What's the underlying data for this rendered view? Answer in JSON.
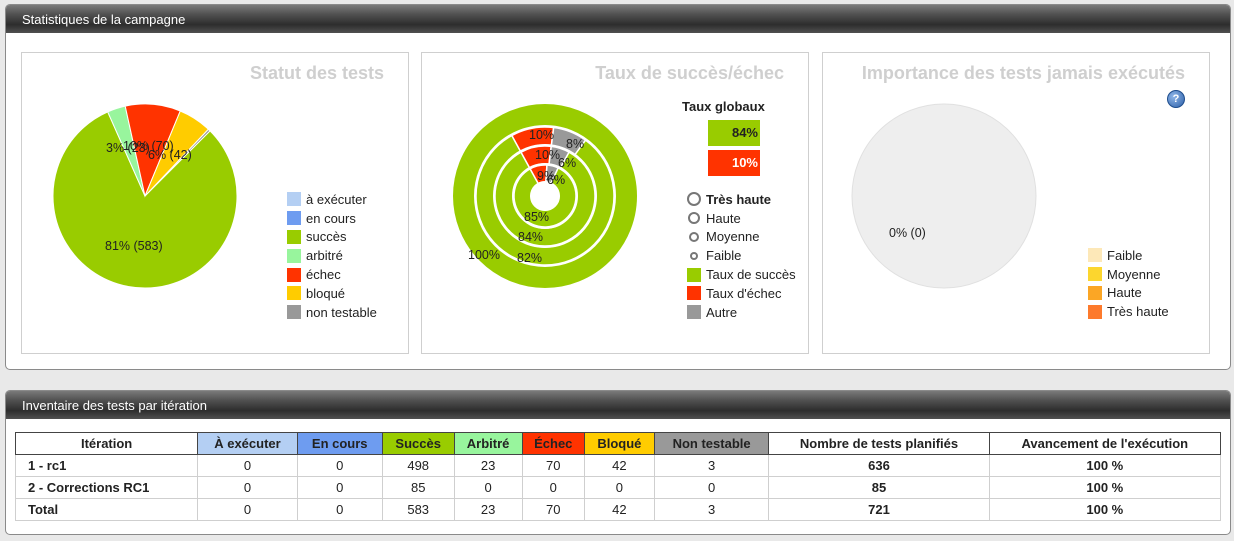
{
  "campaign_panel": {
    "title": "Statistiques de la campagne"
  },
  "status_chart": {
    "title": "Statut des tests",
    "legend": [
      {
        "label": "à exécuter",
        "color": "#b4cff3"
      },
      {
        "label": "en cours",
        "color": "#6e9cf0"
      },
      {
        "label": "succès",
        "color": "#99cc00"
      },
      {
        "label": "arbitré",
        "color": "#98f59d"
      },
      {
        "label": "échec",
        "color": "#ff3300"
      },
      {
        "label": "bloqué",
        "color": "#ffcc00"
      },
      {
        "label": "non testable",
        "color": "#999999"
      }
    ],
    "labels": {
      "success": "81% (583)",
      "arbitrated": "3% (23)",
      "failure": "10% (70)",
      "blocked": "6% (42)"
    }
  },
  "rate_chart": {
    "title": "Taux de succès/échec",
    "global_title": "Taux globaux",
    "global_success": "84%",
    "global_failure": "10%",
    "ring_labels": {
      "outer_success": "100%",
      "r3_success": "82%",
      "r3_failure": "10%",
      "r3_other": "8%",
      "r2_success": "84%",
      "r2_failure": "10%",
      "r2_other": "6%",
      "r1_success": "85%",
      "r1_failure": "9%",
      "r1_other": "6%"
    },
    "legend": [
      {
        "label": "Très haute",
        "type": "ring"
      },
      {
        "label": "Haute",
        "type": "ring"
      },
      {
        "label": "Moyenne",
        "type": "ring"
      },
      {
        "label": "Faible",
        "type": "ring"
      },
      {
        "label": "Taux de succès",
        "color": "#99cc00"
      },
      {
        "label": "Taux d'échec",
        "color": "#ff3300"
      },
      {
        "label": "Autre",
        "color": "#999999"
      }
    ]
  },
  "importance_chart": {
    "title": "Importance des tests jamais exécutés",
    "help": "?",
    "pie_label": "0% (0)",
    "legend": [
      {
        "label": "Faible",
        "color": "#fde8b8"
      },
      {
        "label": "Moyenne",
        "color": "#fcd62e"
      },
      {
        "label": "Haute",
        "color": "#fba625"
      },
      {
        "label": "Très haute",
        "color": "#fd7a2c"
      }
    ]
  },
  "chart_data": [
    {
      "type": "pie",
      "title": "Statut des tests",
      "categories": [
        "à exécuter",
        "en cours",
        "succès",
        "arbitré",
        "échec",
        "bloqué",
        "non testable"
      ],
      "values": [
        0,
        0,
        583,
        23,
        70,
        42,
        3
      ]
    },
    {
      "type": "pie",
      "title": "Taux de succès/échec",
      "rings": [
        {
          "name": "Très haute",
          "success": 100,
          "failure": 0,
          "other": 0
        },
        {
          "name": "Haute",
          "success": 82,
          "failure": 10,
          "other": 8
        },
        {
          "name": "Moyenne",
          "success": 84,
          "failure": 10,
          "other": 6
        },
        {
          "name": "Faible",
          "success": 85,
          "failure": 9,
          "other": 6
        }
      ],
      "global": {
        "success": 84,
        "failure": 10
      }
    },
    {
      "type": "pie",
      "title": "Importance des tests jamais exécutés",
      "categories": [
        "Faible",
        "Moyenne",
        "Haute",
        "Très haute"
      ],
      "values": [
        0,
        0,
        0,
        0
      ]
    }
  ],
  "inventory_panel": {
    "title": "Inventaire des tests par itération",
    "headers": [
      {
        "label": "Itération",
        "bg": "#ffffff",
        "color": "#222222"
      },
      {
        "label": "À exécuter",
        "bg": "#b4cff3",
        "color": "#222222"
      },
      {
        "label": "En cours",
        "bg": "#6e9cf0",
        "color": "#222222"
      },
      {
        "label": "Succès",
        "bg": "#99cc00",
        "color": "#222222"
      },
      {
        "label": "Arbitré",
        "bg": "#98f59d",
        "color": "#222222"
      },
      {
        "label": "Échec",
        "bg": "#ff3300",
        "color": "#222222"
      },
      {
        "label": "Bloqué",
        "bg": "#ffcc00",
        "color": "#222222"
      },
      {
        "label": "Non testable",
        "bg": "#999999",
        "color": "#222222"
      },
      {
        "label": "Nombre de tests planifiés",
        "bg": "#ffffff",
        "color": "#222222"
      },
      {
        "label": "Avancement de l'exécution",
        "bg": "#ffffff",
        "color": "#222222"
      }
    ],
    "rows": [
      [
        "1 - rc1",
        "0",
        "0",
        "498",
        "23",
        "70",
        "42",
        "3",
        "636",
        "100 %"
      ],
      [
        "2 - Corrections RC1",
        "0",
        "0",
        "85",
        "0",
        "0",
        "0",
        "0",
        "85",
        "100 %"
      ],
      [
        "Total",
        "0",
        "0",
        "583",
        "23",
        "70",
        "42",
        "3",
        "721",
        "100 %"
      ]
    ]
  }
}
